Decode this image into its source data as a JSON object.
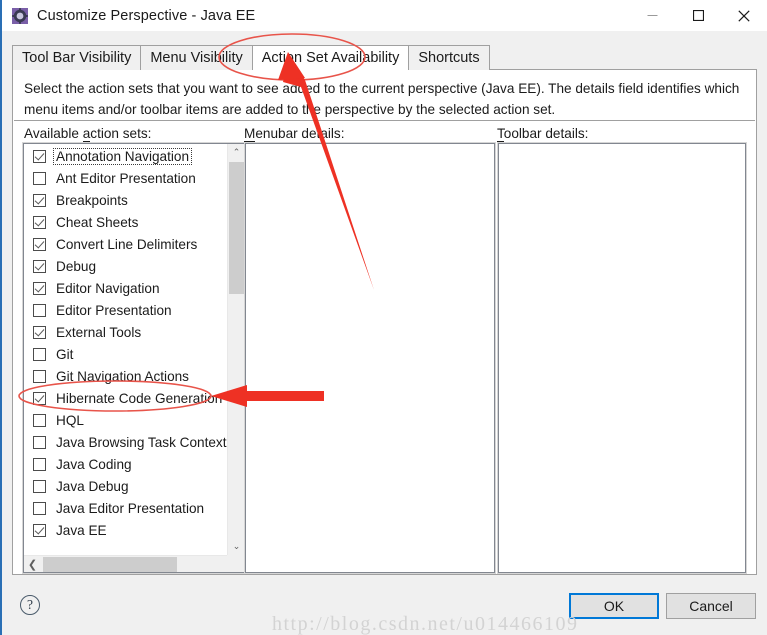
{
  "window": {
    "title": "Customize Perspective - Java EE",
    "icon": "perspective-gear-icon",
    "minimize_label": "─",
    "maximize_label": "□",
    "close_label": "✕"
  },
  "tabs": [
    {
      "label": "Tool Bar Visibility",
      "active": false
    },
    {
      "label": "Menu Visibility",
      "active": false
    },
    {
      "label": "Action Set Availability",
      "active": true
    },
    {
      "label": "Shortcuts",
      "active": false
    }
  ],
  "description": "Select the action sets that you want to see added to the current perspective (Java EE).  The details field identifies which menu items and/or toolbar items are added to the perspective by the selected action set.",
  "columns": {
    "available": "Available action sets:",
    "available_mnemonic": "a",
    "menubar": "Menubar details:",
    "menubar_mnemonic": "M",
    "toolbar": "Toolbar details:",
    "toolbar_mnemonic": "T"
  },
  "action_sets": [
    {
      "label": "Annotation Navigation",
      "checked": true,
      "focused": true
    },
    {
      "label": "Ant Editor Presentation",
      "checked": false,
      "focused": false
    },
    {
      "label": "Breakpoints",
      "checked": true,
      "focused": false
    },
    {
      "label": "Cheat Sheets",
      "checked": true,
      "focused": false
    },
    {
      "label": "Convert Line Delimiters",
      "checked": true,
      "focused": false
    },
    {
      "label": "Debug",
      "checked": true,
      "focused": false
    },
    {
      "label": "Editor Navigation",
      "checked": true,
      "focused": false
    },
    {
      "label": "Editor Presentation",
      "checked": false,
      "focused": false
    },
    {
      "label": "External Tools",
      "checked": true,
      "focused": false
    },
    {
      "label": "Git",
      "checked": false,
      "focused": false
    },
    {
      "label": "Git Navigation Actions",
      "checked": false,
      "focused": false
    },
    {
      "label": "Hibernate Code Generation",
      "checked": true,
      "focused": false
    },
    {
      "label": "HQL",
      "checked": false,
      "focused": false
    },
    {
      "label": "Java Browsing Task Context",
      "checked": false,
      "focused": false
    },
    {
      "label": "Java Coding",
      "checked": false,
      "focused": false
    },
    {
      "label": "Java Debug",
      "checked": false,
      "focused": false
    },
    {
      "label": "Java Editor Presentation",
      "checked": false,
      "focused": false
    },
    {
      "label": "Java EE",
      "checked": true,
      "focused": false
    }
  ],
  "menubar_details": [],
  "toolbar_details": [],
  "buttons": {
    "help": "?",
    "ok": "OK",
    "cancel": "Cancel"
  },
  "scrollbars": {
    "vertical_up": "⌃",
    "vertical_down": "⌄",
    "horizontal_left": "❮",
    "horizontal_right": "❯"
  },
  "watermark": "http://blog.csdn.net/u014466109",
  "annotations": {
    "tab_ellipse": "red-ellipse-around-action-set-availability-tab",
    "tab_arrow": "red-arrow-pointing-to-action-set-availability-tab",
    "row_ellipse": "red-ellipse-around-hibernate-code-generation",
    "row_arrow": "red-arrow-pointing-to-hibernate-code-generation"
  },
  "colors": {
    "accent": "#0078d7",
    "annotation": "#ee3124",
    "annotation_ellipse": "#e8544a",
    "window_border": "#2a6fb5"
  }
}
